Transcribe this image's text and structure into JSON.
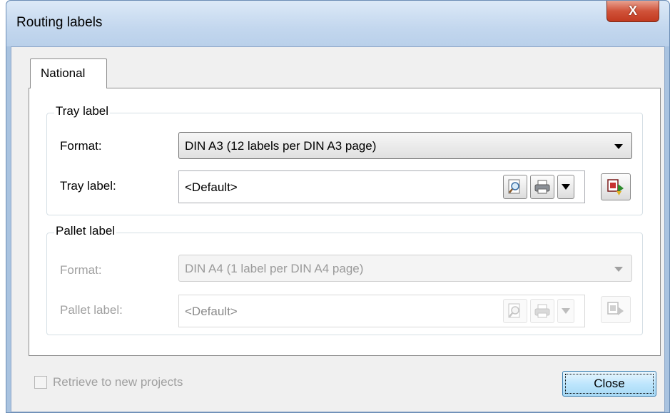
{
  "window": {
    "title": "Routing labels",
    "close_glyph": "X"
  },
  "tabs": [
    {
      "label": "National",
      "selected": true
    }
  ],
  "tray_group": {
    "title": "Tray label",
    "format_label": "Format:",
    "format_value": "DIN A3 (12 labels per DIN A3 page)",
    "label_label": "Tray label:",
    "label_value": "<Default>"
  },
  "pallet_group": {
    "title": "Pallet label",
    "enabled": false,
    "format_label": "Format:",
    "format_value": "DIN A4 (1 label per DIN A4 page)",
    "label_label": "Pallet label:",
    "label_value": "<Default>"
  },
  "footer": {
    "retrieve_label": "Retrieve to new projects",
    "retrieve_checked": false,
    "retrieve_enabled": false,
    "close_label": "Close"
  },
  "icons": [
    "preview-icon",
    "printer-icon",
    "dropdown-arrow-icon",
    "import-label-icon"
  ],
  "colors": {
    "titlebar": "#c3d7ee",
    "close_button": "#c2391f",
    "focus_button": "#bee6fd"
  }
}
